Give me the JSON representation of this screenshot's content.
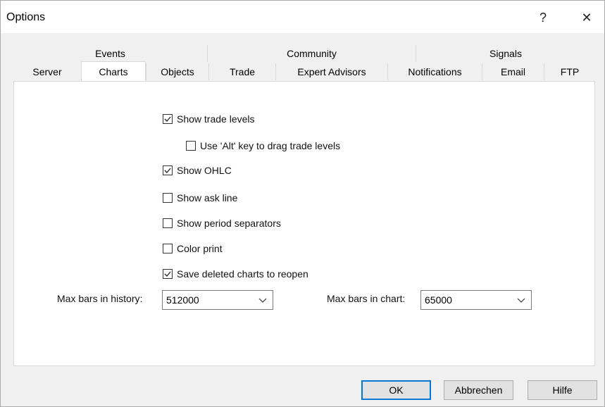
{
  "window": {
    "title": "Options",
    "help_label": "?",
    "close_label": "✕"
  },
  "tabs": {
    "top_row": [
      "Events",
      "Community",
      "Signals"
    ],
    "bottom_row": [
      "Server",
      "Charts",
      "Objects",
      "Trade",
      "Expert Advisors",
      "Notifications",
      "Email",
      "FTP"
    ],
    "active": "Charts"
  },
  "charts": {
    "options": [
      {
        "label": "Show trade levels",
        "checked": true
      },
      {
        "label": "Use 'Alt' key to drag trade levels",
        "checked": false
      },
      {
        "label": "Show OHLC",
        "checked": true
      },
      {
        "label": "Show ask line",
        "checked": false
      },
      {
        "label": "Show period separators",
        "checked": false
      },
      {
        "label": "Color print",
        "checked": false
      },
      {
        "label": "Save deleted charts to reopen",
        "checked": true
      }
    ],
    "max_bars_history": {
      "label": "Max bars in history:",
      "value": "512000"
    },
    "max_bars_chart": {
      "label": "Max bars in chart:",
      "value": "65000"
    }
  },
  "buttons": {
    "ok": "OK",
    "cancel": "Abbrechen",
    "help": "Hilfe"
  }
}
